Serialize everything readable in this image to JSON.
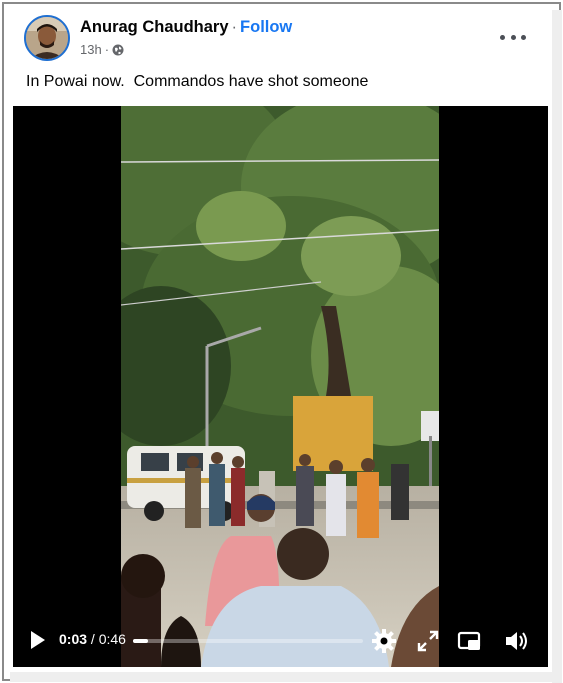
{
  "post": {
    "author": "Anurag Chaudhary",
    "separator": "·",
    "follow_label": "Follow",
    "time": "13h",
    "meta_separator": "·",
    "text": "In Powai now.  Commandos have shot someone"
  },
  "video": {
    "current_time": "0:03",
    "time_separator": " / ",
    "duration": "0:46",
    "progress_fraction": 0.065
  },
  "icons": {
    "privacy": "globe-icon",
    "menu": "more-options-icon",
    "play": "play-icon",
    "settings": "gear-icon",
    "fullscreen": "fullscreen-icon",
    "pip": "picture-in-picture-icon",
    "volume": "volume-icon"
  },
  "colors": {
    "follow": "#1877f2",
    "avatar_ring": "#1f6fd1"
  }
}
